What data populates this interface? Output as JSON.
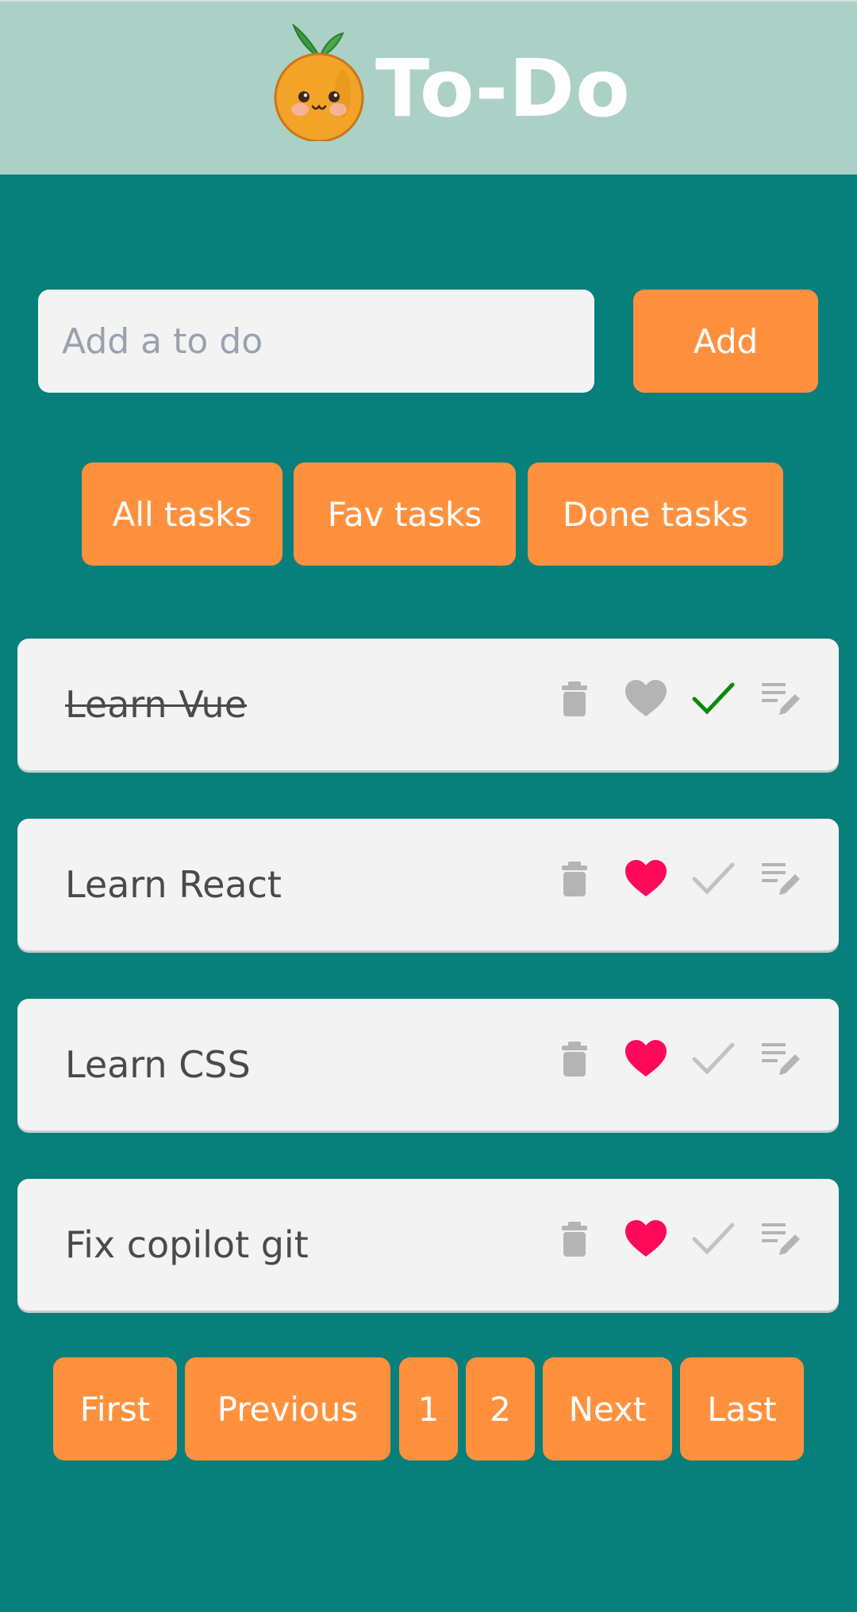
{
  "header": {
    "title": "To-Do",
    "logo": "orange-mascot-icon"
  },
  "new_task": {
    "placeholder": "Add a to do",
    "value": "",
    "add_label": "Add"
  },
  "filters": [
    {
      "label": "All tasks"
    },
    {
      "label": "Fav tasks"
    },
    {
      "label": "Done tasks"
    }
  ],
  "tasks": [
    {
      "text": "Learn Vue",
      "done": true,
      "fav": false
    },
    {
      "text": "Learn React",
      "done": false,
      "fav": true
    },
    {
      "text": "Learn CSS",
      "done": false,
      "fav": true
    },
    {
      "text": "Fix copilot git",
      "done": false,
      "fav": true
    }
  ],
  "icons": {
    "delete": "trash-icon",
    "favorite": "heart-icon",
    "complete": "check-icon",
    "edit": "edit-list-icon"
  },
  "pagination": {
    "first": "First",
    "previous": "Previous",
    "pages": [
      "1",
      "2"
    ],
    "next": "Next",
    "last": "Last"
  },
  "colors": {
    "background": "#077f7b",
    "header": "#abd1c6",
    "accent": "#ff913e",
    "fav_active": "#ff0a5a",
    "done_check": "#0a8a0a",
    "icon_idle": "#b4b4b4"
  }
}
